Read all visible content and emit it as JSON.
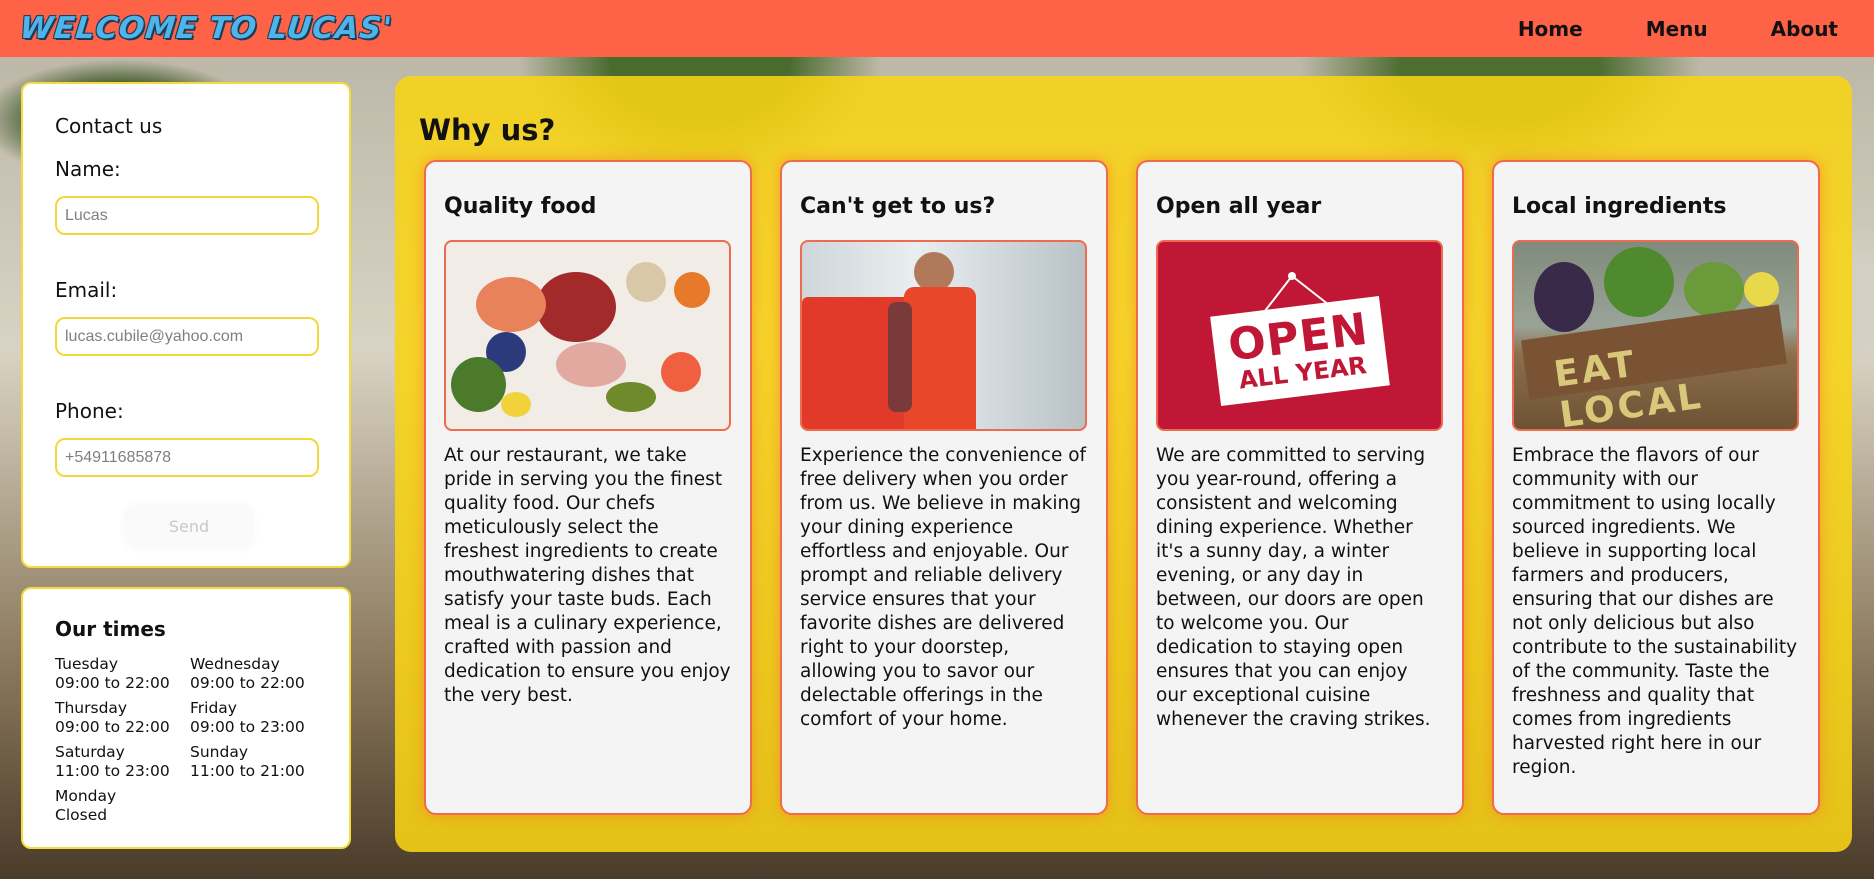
{
  "header": {
    "logo_text": "WELCOME TO LUCAS'",
    "nav": [
      {
        "label": "Home"
      },
      {
        "label": "Menu"
      },
      {
        "label": "About"
      }
    ]
  },
  "contact": {
    "title": "Contact us",
    "name_label": "Name:",
    "name_placeholder": "Lucas",
    "email_label": "Email:",
    "email_placeholder": "lucas.cubile@yahoo.com",
    "phone_label": "Phone:",
    "phone_placeholder": "+54911685878",
    "send_label": "Send"
  },
  "times": {
    "title": "Our times",
    "days": [
      {
        "day": "Tuesday",
        "hours": "09:00 to 22:00"
      },
      {
        "day": "Wednesday",
        "hours": "09:00 to 22:00"
      },
      {
        "day": "Thursday",
        "hours": "09:00 to 22:00"
      },
      {
        "day": "Friday",
        "hours": "09:00 to 23:00"
      },
      {
        "day": "Saturday",
        "hours": "11:00 to 23:00"
      },
      {
        "day": "Sunday",
        "hours": "11:00 to 21:00"
      },
      {
        "day": "Monday",
        "hours": "Closed"
      }
    ]
  },
  "why": {
    "title": "Why us?",
    "cards": [
      {
        "title": "Quality food",
        "image": "assorted-fresh-food-photo",
        "text": "At our restaurant, we take pride in serving you the finest quality food. Our chefs meticulously select the freshest ingredients to create mouthwatering dishes that satisfy your taste buds. Each meal is a culinary experience, crafted with passion and dedication to ensure you enjoy the very best."
      },
      {
        "title": "Can't get to us?",
        "image": "delivery-man-photo",
        "text": "Experience the convenience of free delivery when you order from us. We believe in making your dining experience effortless and enjoyable. Our prompt and reliable delivery service ensures that your favorite dishes are delivered right to your doorstep, allowing you to savor our delectable offerings in the comfort of your home."
      },
      {
        "title": "Open all year",
        "image": "open-all-year-sign",
        "sign_line1": "OPEN",
        "sign_line2": "ALL YEAR",
        "text": "We are committed to serving you year-round, offering a consistent and welcoming dining experience. Whether it's a sunny day, a winter evening, or any day in between, our doors are open to welcome you. Our dedication to staying open ensures that you can enjoy our exceptional cuisine whenever the craving strikes."
      },
      {
        "title": "Local ingredients",
        "image": "eat-local-crate-photo",
        "crate_text": "EAT LOCAL",
        "text": "Embrace the flavors of our community with our commitment to using locally sourced ingredients. We believe in supporting local farmers and producers, ensuring that our dishes are not only delicious but also contribute to the sustainability of the community. Taste the freshness and quality that comes from ingredients harvested right here in our region."
      }
    ]
  },
  "colors": {
    "header_bg": "#ff6347",
    "panel_yellow": "#f8d414",
    "card_border": "#f06b4c",
    "input_border": "#f3d83a"
  }
}
